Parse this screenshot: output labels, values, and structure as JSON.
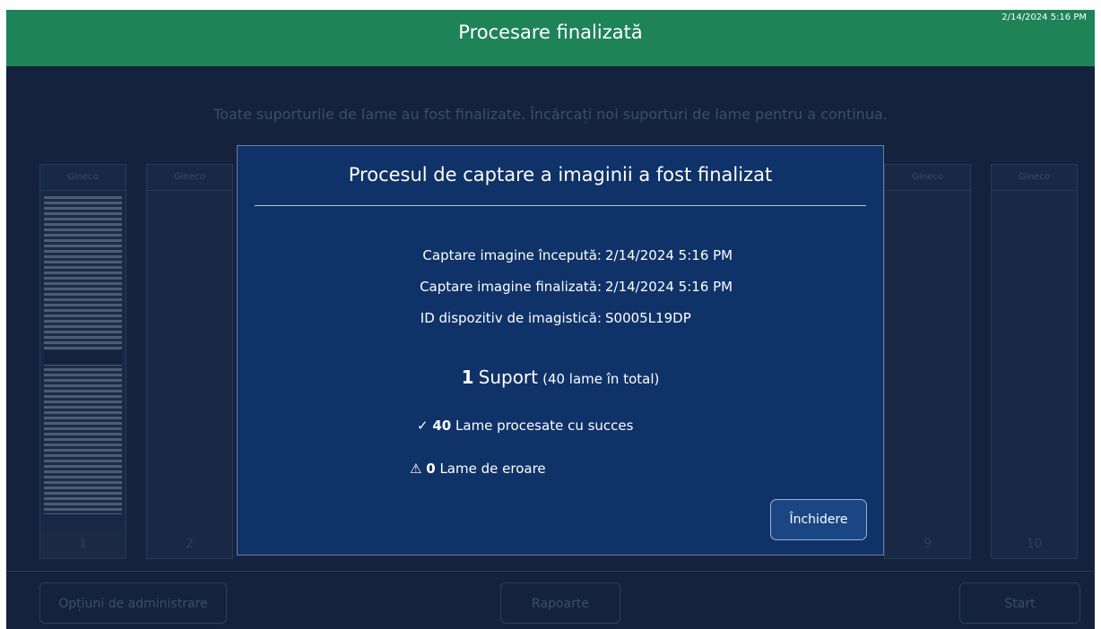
{
  "header": {
    "title": "Procesare finalizată",
    "timestamp": "2/14/2024 5:16 PM"
  },
  "info_text": "Toate suporturile de lame au fost finalizate. Încărcați noi suporturi de lame pentru a continua.",
  "racks": [
    {
      "label": "Gineco",
      "number": "1"
    },
    {
      "label": "Gineco",
      "number": "2"
    },
    {
      "label": "Gineco",
      "number": "9"
    },
    {
      "label": "Gineco",
      "number": "10"
    }
  ],
  "footer": {
    "admin_label": "Opțiuni de administrare",
    "reports_label": "Rapoarte",
    "start_label": "Start"
  },
  "modal": {
    "title": "Procesul de captare a imaginii a fost finalizat",
    "details": [
      {
        "label": "Captare imagine începută:",
        "value": "2/14/2024 5:16 PM"
      },
      {
        "label": "Captare imagine finalizată:",
        "value": "2/14/2024 5:16 PM"
      },
      {
        "label": "ID dispozitiv de imagistică:",
        "value": "S0005L19DP"
      }
    ],
    "summary": {
      "count": "1",
      "unit": "Suport",
      "total": "(40 lame în total)"
    },
    "success": {
      "icon": "check-icon",
      "count": "40",
      "label": "Lame procesate cu succes"
    },
    "error": {
      "icon": "warning-icon",
      "count": "0",
      "label": "Lame de eroare"
    },
    "close_label": "Închidere"
  },
  "colors": {
    "header": "#1f8358",
    "background": "#14223d",
    "modal": "#0f3268"
  }
}
